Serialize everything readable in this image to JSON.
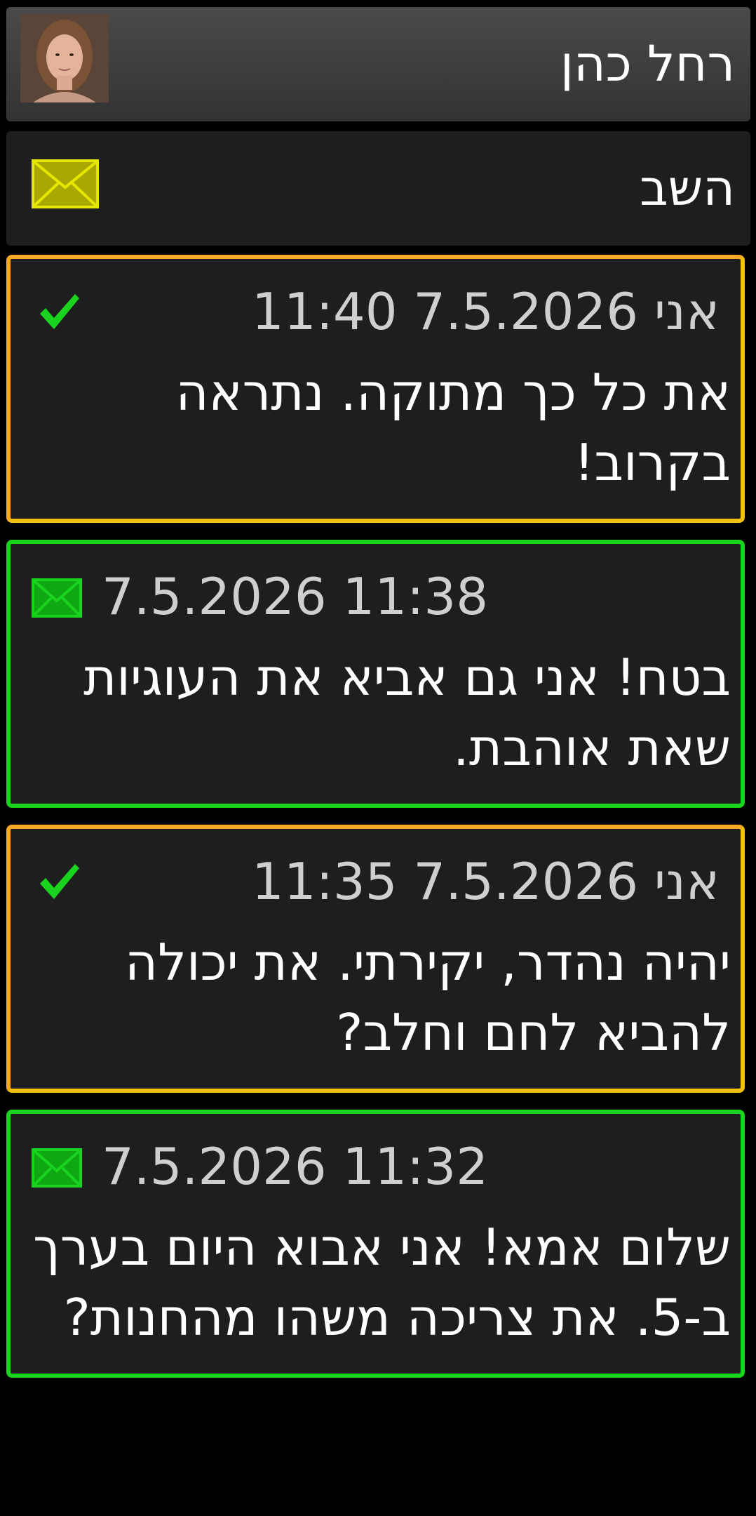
{
  "header": {
    "contact_name": "רחל כהן",
    "avatar_icon": "person-avatar"
  },
  "reply": {
    "label": "השב",
    "icon": "envelope-icon",
    "icon_color": "#e6e600"
  },
  "colors": {
    "sent_border": "#f5b820",
    "received_border": "#19d31f",
    "check": "#19d31f"
  },
  "messages": [
    {
      "direction": "sent",
      "meta": "אני 7.5.2026 11:40",
      "text": "את כל כך מתוקה. נתראה בקרוב!",
      "status_icon": "check-icon"
    },
    {
      "direction": "received",
      "meta": "7.5.2026 11:38",
      "text": "בטח! אני גם אביא את העוגיות שאת אוהבת.",
      "status_icon": "envelope-icon"
    },
    {
      "direction": "sent",
      "meta": "אני 7.5.2026 11:35",
      "text": "יהיה נהדר, יקירתי. את יכולה להביא לחם וחלב?",
      "status_icon": "check-icon"
    },
    {
      "direction": "received",
      "meta": "7.5.2026 11:32",
      "text": "שלום אמא! אני אבוא היום בערך ב-5. את צריכה משהו מהחנות?",
      "status_icon": "envelope-icon"
    }
  ]
}
